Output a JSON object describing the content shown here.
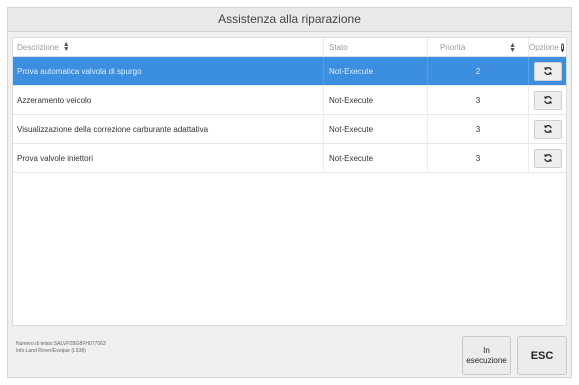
{
  "window": {
    "title": "Assistenza alla riparazione"
  },
  "table": {
    "headers": {
      "description": "Descrizione",
      "status": "Stato",
      "priority": "Priorità",
      "options": "Opzione"
    },
    "rows": [
      {
        "description": "Prova automatica valvola di spurgo",
        "status": "Not-Execute",
        "priority": "2",
        "selected": true
      },
      {
        "description": "Azzeramento veicolo",
        "status": "Not-Execute",
        "priority": "3",
        "selected": false
      },
      {
        "description": "Visualizzazione della correzione carburante adattativa",
        "status": "Not-Execute",
        "priority": "3",
        "selected": false
      },
      {
        "description": "Prova valvole iniettori",
        "status": "Not-Execute",
        "priority": "3",
        "selected": false
      }
    ]
  },
  "footer": {
    "vin_line": "Numero di telaio:SALVP2BG8FH077063",
    "vehicle_line": "Info:Land Rover/Evoque (L538)",
    "run_label_1": "In",
    "run_label_2": "esecuzione",
    "esc_label": "ESC"
  },
  "icons": {
    "sort": "sort-icon",
    "info": "info-icon",
    "refresh": "refresh-icon"
  },
  "colors": {
    "selected_row": "#3b8ee0",
    "background": "#f0f0f0"
  }
}
